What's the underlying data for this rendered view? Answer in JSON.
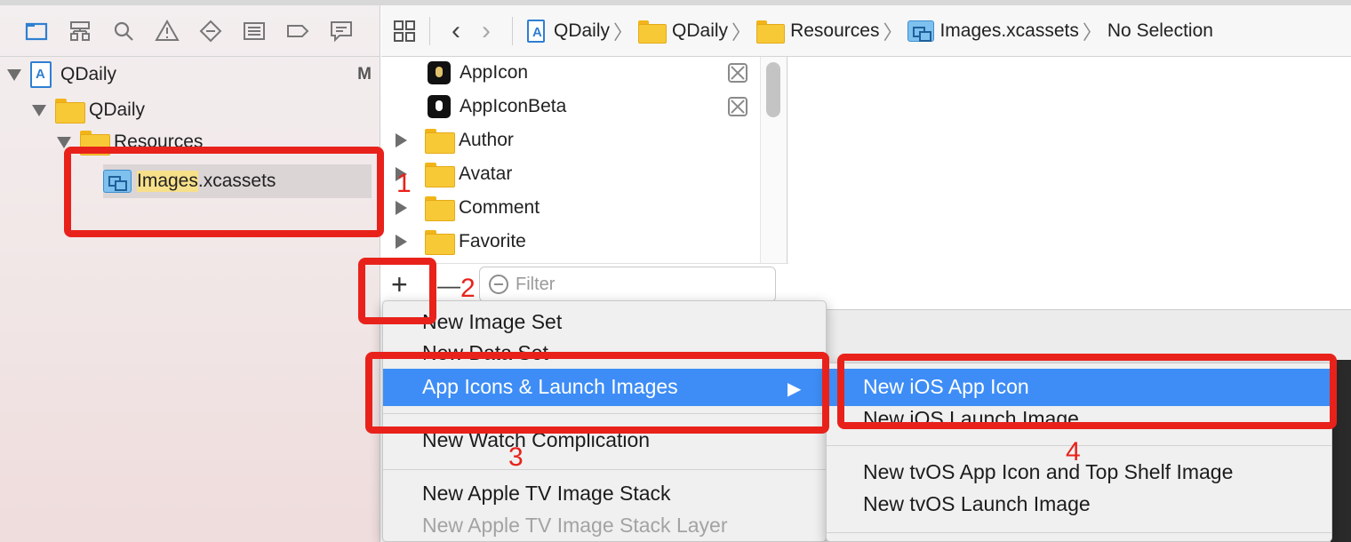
{
  "navigator": {
    "tabs": [
      "project-navigator-icon",
      "symbol-navigator-icon",
      "find-navigator-icon",
      "issue-navigator-icon",
      "test-navigator-icon",
      "debug-navigator-icon",
      "breakpoint-navigator-icon",
      "report-navigator-icon"
    ],
    "tree": {
      "project": {
        "label": "QDaily",
        "badge": "M"
      },
      "group": {
        "label": "QDaily"
      },
      "folder": {
        "label": "Resources"
      },
      "catalog": {
        "label_hl": "Images",
        "label_rest": ".xcassets"
      }
    }
  },
  "jumpbar": {
    "crumbs": [
      "QDaily",
      "QDaily",
      "Resources",
      "Images.xcassets",
      "No Selection"
    ]
  },
  "assets": {
    "items": [
      {
        "label": "AppIcon"
      },
      {
        "label": "AppIconBeta"
      },
      {
        "label": "Author"
      },
      {
        "label": "Avatar"
      },
      {
        "label": "Comment"
      },
      {
        "label": "Favorite"
      }
    ],
    "add_label": "+",
    "remove_label": "—",
    "filter_placeholder": "Filter"
  },
  "menu": {
    "items": [
      "New Image Set",
      "New Data Set",
      "App Icons & Launch Images",
      "New Watch Complication",
      "New Apple TV Image Stack",
      "New Apple TV Image Stack Layer"
    ],
    "submenu_arrow": "▶"
  },
  "submenu": {
    "items": [
      "New iOS App Icon",
      "New iOS Launch Image",
      "New tvOS App Icon and Top Shelf Image",
      "New tvOS Launch Image"
    ]
  },
  "annotations": [
    "1",
    "2",
    "3",
    "4"
  ],
  "colors": {
    "annotation": "#e8221b",
    "menu_highlight": "#3e8df6",
    "folder": "#f8c937"
  }
}
